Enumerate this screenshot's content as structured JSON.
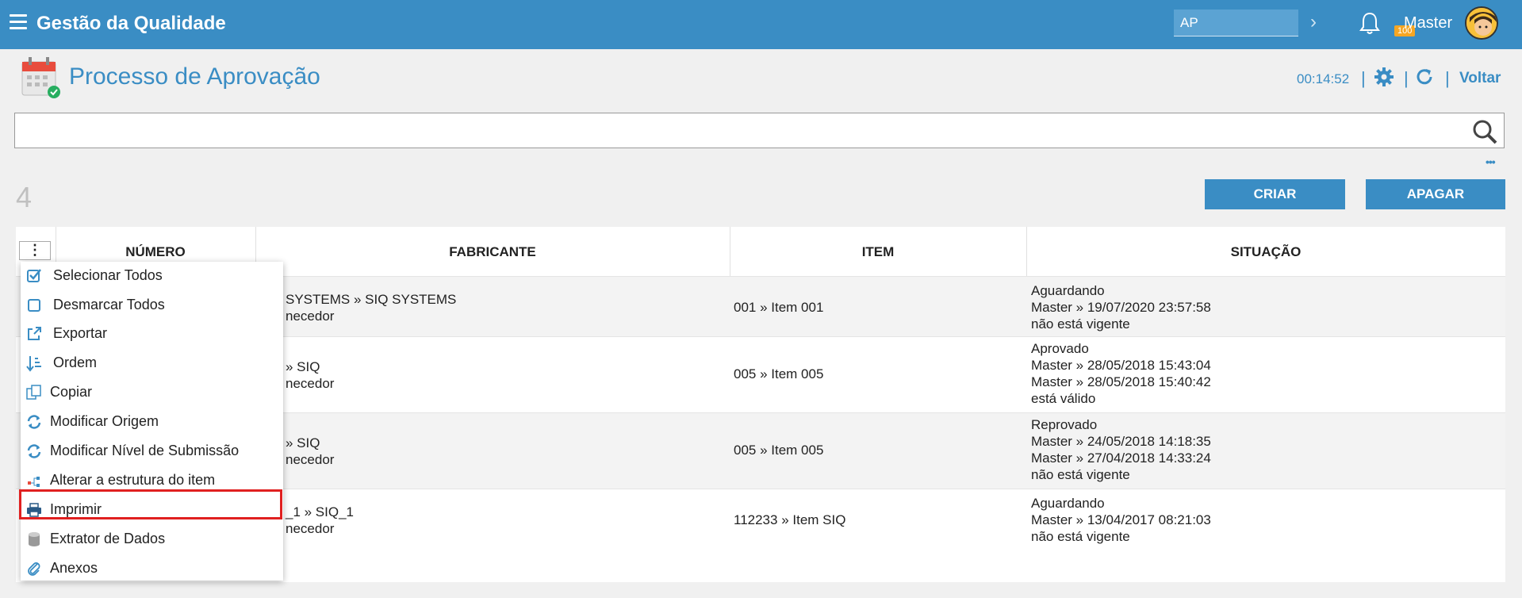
{
  "app": {
    "title": "Gestão da Qualidade",
    "search_value": "AP",
    "notification_count": "100",
    "user": "Master"
  },
  "page": {
    "title": "Processo de Aprovação",
    "timer": "00:14:52",
    "back_label": "Voltar",
    "separator": "|"
  },
  "search": {
    "value": "",
    "more": "•••"
  },
  "toolbar": {
    "count": "4",
    "create_label": "CRIAR",
    "delete_label": "APAGAR"
  },
  "table": {
    "menu_glyph": "⋮",
    "headers": [
      "NÚMERO",
      "FABRICANTE",
      "ITEM",
      "SITUAÇÃO"
    ],
    "rows": [
      {
        "fabricante": [
          "SYSTEMS » SIQ SYSTEMS",
          "necedor"
        ],
        "item": "001 » Item 001",
        "situacao": [
          "Aguardando",
          "Master » 19/07/2020 23:57:58",
          "não está vigente"
        ]
      },
      {
        "fabricante": [
          "» SIQ",
          "necedor"
        ],
        "item": "005 » Item 005",
        "situacao": [
          "Aprovado",
          "Master » 28/05/2018 15:43:04",
          "Master » 28/05/2018 15:40:42",
          "está válido"
        ]
      },
      {
        "fabricante": [
          "» SIQ",
          "necedor"
        ],
        "item": "005 » Item 005",
        "situacao": [
          "Reprovado",
          "Master » 24/05/2018 14:18:35",
          "Master » 27/04/2018 14:33:24",
          "não está vigente"
        ]
      },
      {
        "fabricante": [
          "_1 » SIQ_1",
          "necedor"
        ],
        "item": "112233 » Item SIQ",
        "situacao": [
          "Aguardando",
          "Master » 13/04/2017 08:21:03",
          "não está vigente"
        ]
      }
    ]
  },
  "menu": {
    "items": [
      {
        "label": "Selecionar Todos",
        "icon": "checkbox-checked-icon"
      },
      {
        "label": "Desmarcar Todos",
        "icon": "checkbox-empty-icon"
      },
      {
        "label": "Exportar",
        "icon": "external-link-icon"
      },
      {
        "label": "Ordem",
        "icon": "sort-icon"
      },
      {
        "label": "Copiar",
        "icon": "copy-icon"
      },
      {
        "label": "Modificar Origem",
        "icon": "sync-icon"
      },
      {
        "label": "Modificar Nível de Submissão",
        "icon": "sync-icon"
      },
      {
        "label": "Alterar a estrutura do item",
        "icon": "structure-icon"
      },
      {
        "label": "Imprimir",
        "icon": "printer-icon"
      },
      {
        "label": "Extrator de Dados",
        "icon": "database-icon"
      },
      {
        "label": "Anexos",
        "icon": "paperclip-icon"
      }
    ]
  },
  "colors": {
    "primary": "#3a8dc4",
    "highlight": "#e02020",
    "badge": "#f5a623"
  }
}
